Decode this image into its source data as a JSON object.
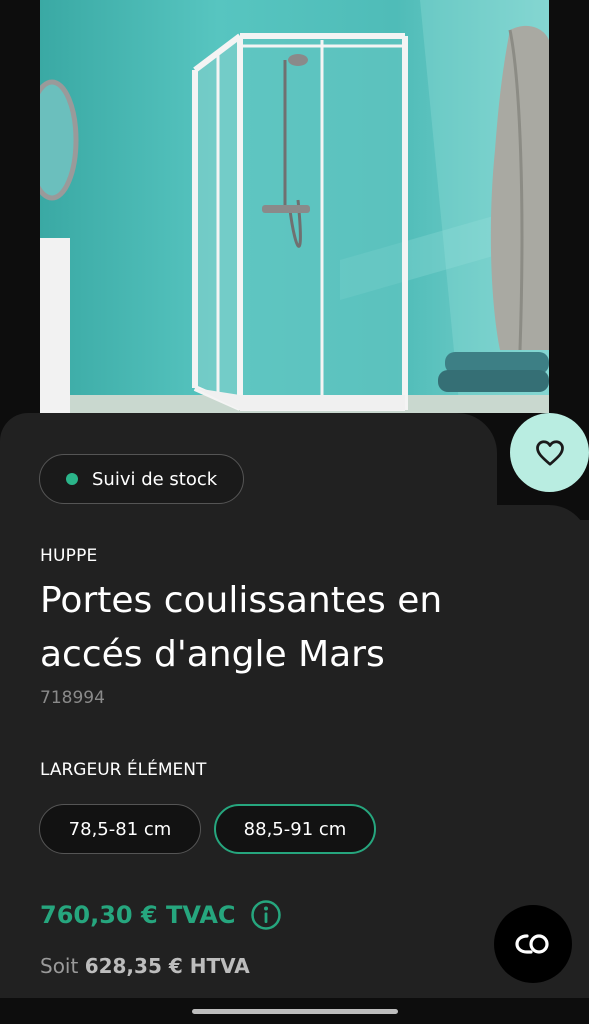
{
  "product": {
    "stock_label": "Suivi de stock",
    "brand": "HUPPE",
    "title": "Portes coulissantes en accés d'angle Mars",
    "reference": "718994"
  },
  "options": {
    "label": "LARGEUR ÉLÉMENT",
    "items": [
      {
        "label": "78,5-81 cm",
        "selected": false
      },
      {
        "label": "88,5-91 cm",
        "selected": true
      }
    ]
  },
  "pricing": {
    "price_tvac": "760,30 € TVAC",
    "subprice_prefix": "Soit",
    "price_htva": "628,35 € HTVA"
  },
  "icons": {
    "favorite": "heart-icon",
    "info": "info-icon",
    "fab": "chat-bubbles-icon"
  },
  "colors": {
    "accent": "#26a67e",
    "favorite_bg": "#b9ede1",
    "sheet_bg": "#212121"
  }
}
